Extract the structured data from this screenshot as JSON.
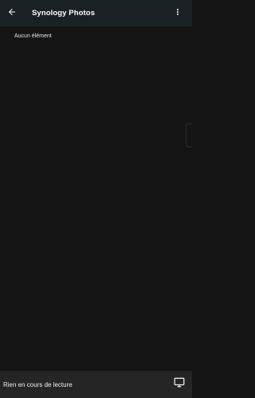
{
  "header": {
    "title": "Synology Photos",
    "back_icon": "arrow-left-icon",
    "more_icon": "more-vert-icon"
  },
  "content": {
    "empty_message": "Aucun élément"
  },
  "player": {
    "status_text": "Rien en cours de lecture",
    "cast_icon": "monitor-cast-icon"
  },
  "colors": {
    "background": "#141414",
    "app_bar": "#1a2125",
    "player_bar": "#252525",
    "text": "#ffffff"
  }
}
